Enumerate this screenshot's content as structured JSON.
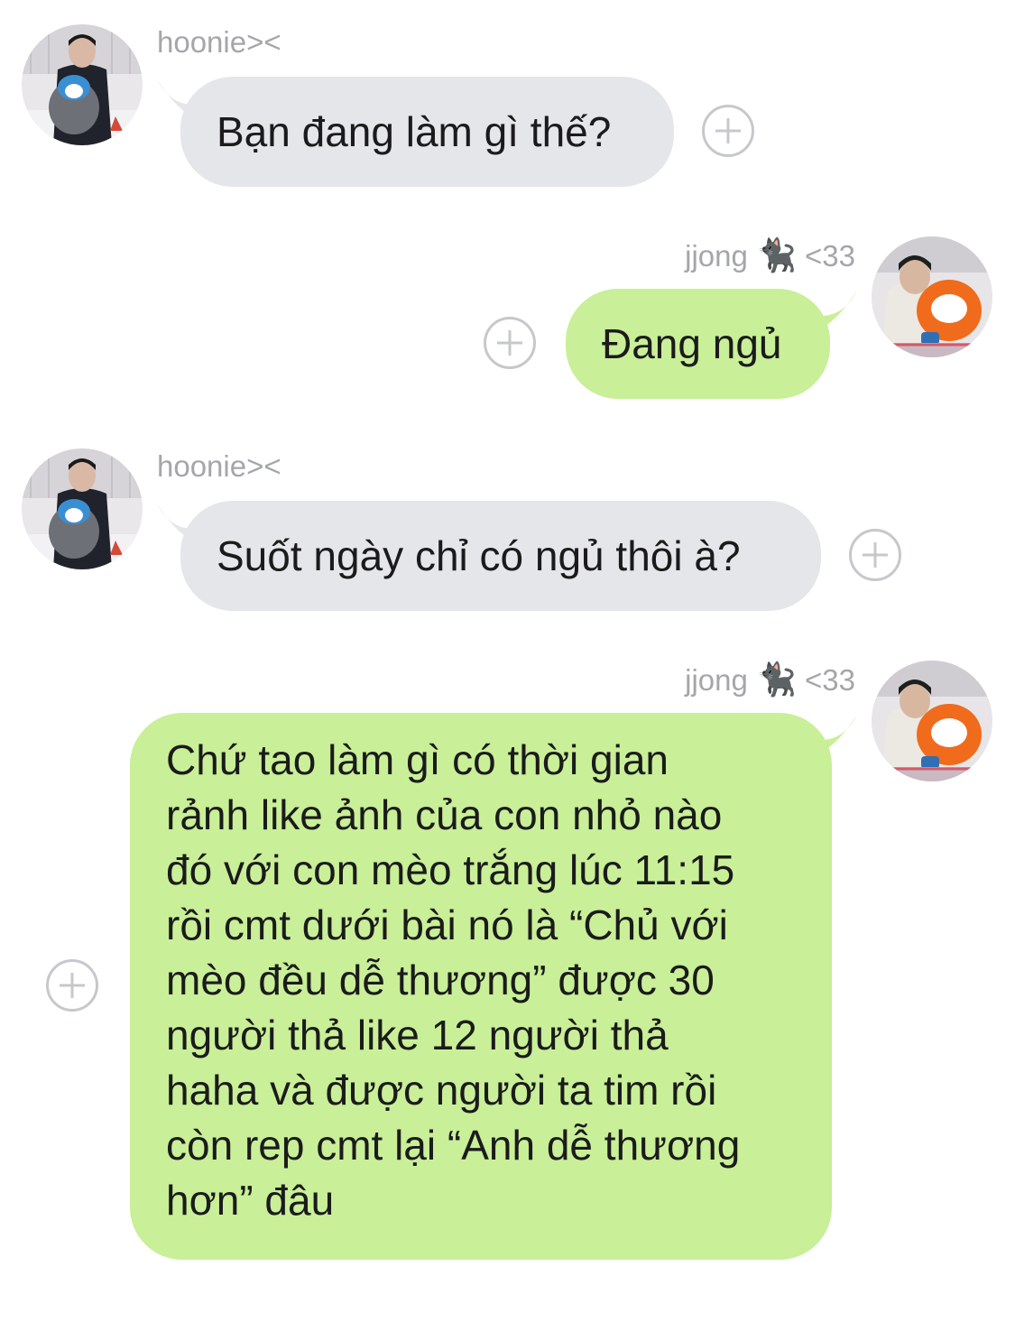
{
  "messages": [
    {
      "direction": "incoming",
      "sender": "hoonie><",
      "text": "Bạn đang làm gì thế?"
    },
    {
      "direction": "outgoing",
      "sender_name": "jjong",
      "sender_emoji": "🐈‍⬛",
      "sender_suffix": "<33",
      "text": "Đang ngủ"
    },
    {
      "direction": "incoming",
      "sender": "hoonie><",
      "text": "Suốt ngày chỉ có ngủ thôi à?"
    },
    {
      "direction": "outgoing",
      "sender_name": "jjong",
      "sender_emoji": "🐈‍⬛",
      "sender_suffix": "<33",
      "text": "Chứ tao làm gì có thời gian\nrảnh like ảnh của con nhỏ nào\nđó với con mèo trắng lúc 11:15\nrồi cmt dưới bài nó là “Chủ với\nmèo đều dễ thương” được 30\nngười thả like 12 người thả\nhaha và được người ta tim rồi\ncòn rep cmt lại “Anh dễ thương\nhơn” đâu"
    }
  ],
  "colors": {
    "incoming_bubble": "#e4e6ea",
    "outgoing_bubble": "#c9ef98",
    "sender_text": "#a4a6a9",
    "plus_icon": "#c6c8cb"
  },
  "icons": {
    "add_reaction": "plus-circle-icon",
    "avatar_incoming": "user-avatar-penguin",
    "avatar_outgoing": "user-avatar-hoodie"
  }
}
